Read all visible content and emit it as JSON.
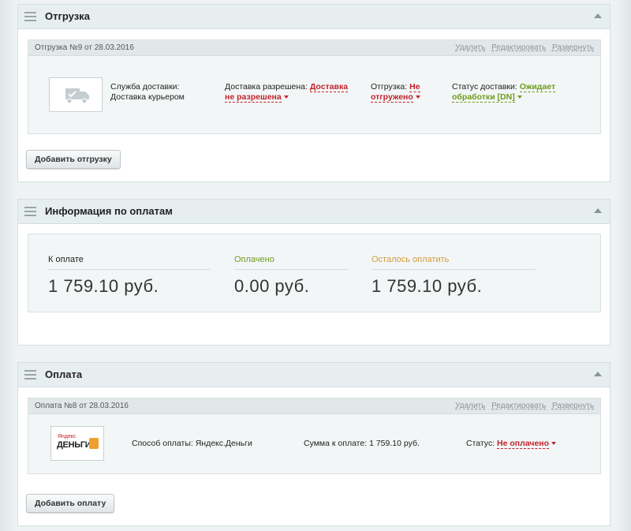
{
  "colors": {
    "accent_red": "#c0232c",
    "accent_green": "#6e9b1e",
    "accent_orange": "#d49a3c",
    "header_bg": "#e6eef0"
  },
  "shipment_section": {
    "title": "Отгрузка",
    "menu_icon": "hamburger-icon",
    "collapse_icon": "triangle-up-icon",
    "shipment": {
      "title": "Отгрузка №9 от 28.03.2016",
      "links": [
        "Удалить",
        "Редактировать",
        "Развернуть"
      ],
      "thumb_icon": "delivery-truck-icon",
      "service_label": "Служба доставки:",
      "service_value": "Доставка курьером",
      "allowed_label": "Доставка разрешена:",
      "allowed_value_1": "Доставка",
      "allowed_value_2": "не разрешена",
      "shipped_label": "Отгрузка:",
      "shipped_value_1": "Не",
      "shipped_value_2": "отгружено",
      "status_label": "Статус доставки:",
      "status_value_1": "Ожидает",
      "status_value_2": "обработки [DN]"
    },
    "add_button": "Добавить отгрузку"
  },
  "payment_info_section": {
    "title": "Информация по оплатам",
    "columns": [
      {
        "label": "К оплате",
        "value": "1 759.10 руб.",
        "color": "#333333"
      },
      {
        "label": "Оплачено",
        "value": "0.00 руб.",
        "color": "#6e9b1e"
      },
      {
        "label": "Осталось оплатить",
        "value": "1 759.10 руб.",
        "color": "#d49a3c"
      }
    ]
  },
  "payment_section": {
    "title": "Оплата",
    "payment": {
      "title": "Оплата №8 от 28.03.2016",
      "links": [
        "Удалить",
        "Редактировать",
        "Развернуть"
      ],
      "logo_top": "Яндекс",
      "logo_main": "ДЕНЬГИ",
      "method_label": "Способ оплаты:",
      "method_value": "Яндекс.Деньги",
      "sum_label": "Сумма к оплате:",
      "sum_value": "1 759.10 руб.",
      "status_label": "Статус:",
      "status_value": "Не оплачено"
    },
    "add_button": "Добавить оплату"
  }
}
